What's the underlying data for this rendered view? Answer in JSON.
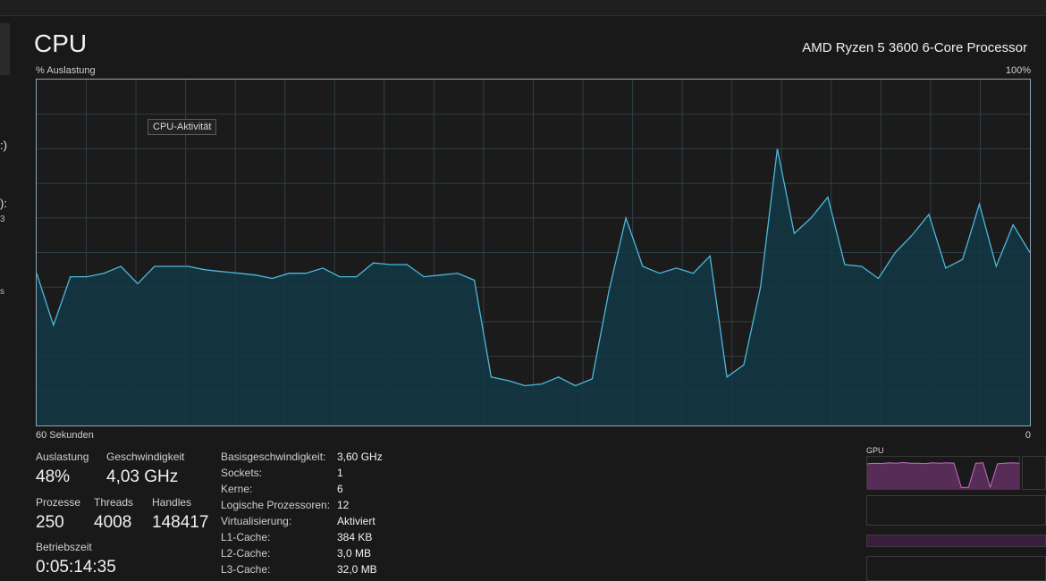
{
  "header": {
    "title": "CPU",
    "processor_name": "AMD Ryzen 5 3600 6-Core Processor"
  },
  "sidebar_fragments": [
    ":)",
    "):",
    "3",
    "s"
  ],
  "graph": {
    "y_label": "% Auslastung",
    "y_max_label": "100%",
    "x_left_label": "60 Sekunden",
    "x_right_label": "0",
    "tooltip": "CPU-Aktivität",
    "line_color": "#4cb8dc",
    "fill_color": "#123845",
    "grid_color": "#2f3f46"
  },
  "chart_data": {
    "type": "area",
    "ylim": [
      0,
      100
    ],
    "grid": true,
    "values": [
      44,
      29,
      43,
      43,
      44,
      46,
      41,
      46,
      46,
      46,
      45,
      44.5,
      44,
      43.5,
      42.5,
      44,
      44,
      45.5,
      43,
      43,
      47,
      46.5,
      46.5,
      43,
      43.5,
      44,
      42,
      14,
      13,
      11.5,
      12,
      14,
      11.5,
      13.5,
      39,
      60,
      46,
      44,
      45.5,
      44,
      49,
      14,
      17.5,
      40,
      80,
      55.5,
      60,
      66,
      46.5,
      46,
      42.5,
      50,
      55,
      61,
      45.5,
      48,
      64,
      46,
      58,
      50
    ]
  },
  "stats": {
    "auslastung": {
      "label": "Auslastung",
      "value": "48%"
    },
    "geschwindigkeit": {
      "label": "Geschwindigkeit",
      "value": "4,03 GHz"
    },
    "prozesse": {
      "label": "Prozesse",
      "value": "250"
    },
    "threads": {
      "label": "Threads",
      "value": "4008"
    },
    "handles": {
      "label": "Handles",
      "value": "148417"
    },
    "betriebszeit": {
      "label": "Betriebszeit",
      "value": "0:05:14:35"
    }
  },
  "details": [
    {
      "label": "Basisgeschwindigkeit:",
      "value": "3,60 GHz"
    },
    {
      "label": "Sockets:",
      "value": "1"
    },
    {
      "label": "Kerne:",
      "value": "6"
    },
    {
      "label": "Logische Prozessoren:",
      "value": "12"
    },
    {
      "label": "Virtualisierung:",
      "value": "Aktiviert"
    },
    {
      "label": "L1-Cache:",
      "value": "384 KB"
    },
    {
      "label": "L2-Cache:",
      "value": "3,0 MB"
    },
    {
      "label": "L3-Cache:",
      "value": "32,0 MB"
    }
  ],
  "gpu_thumbnail": {
    "title": "GPU",
    "accent": "#8a3d8a",
    "usage_values": [
      78,
      80,
      79,
      81,
      80,
      82,
      80,
      80,
      79,
      81,
      80,
      81,
      80,
      5,
      5,
      80,
      81,
      5,
      78,
      80,
      81,
      80
    ]
  }
}
